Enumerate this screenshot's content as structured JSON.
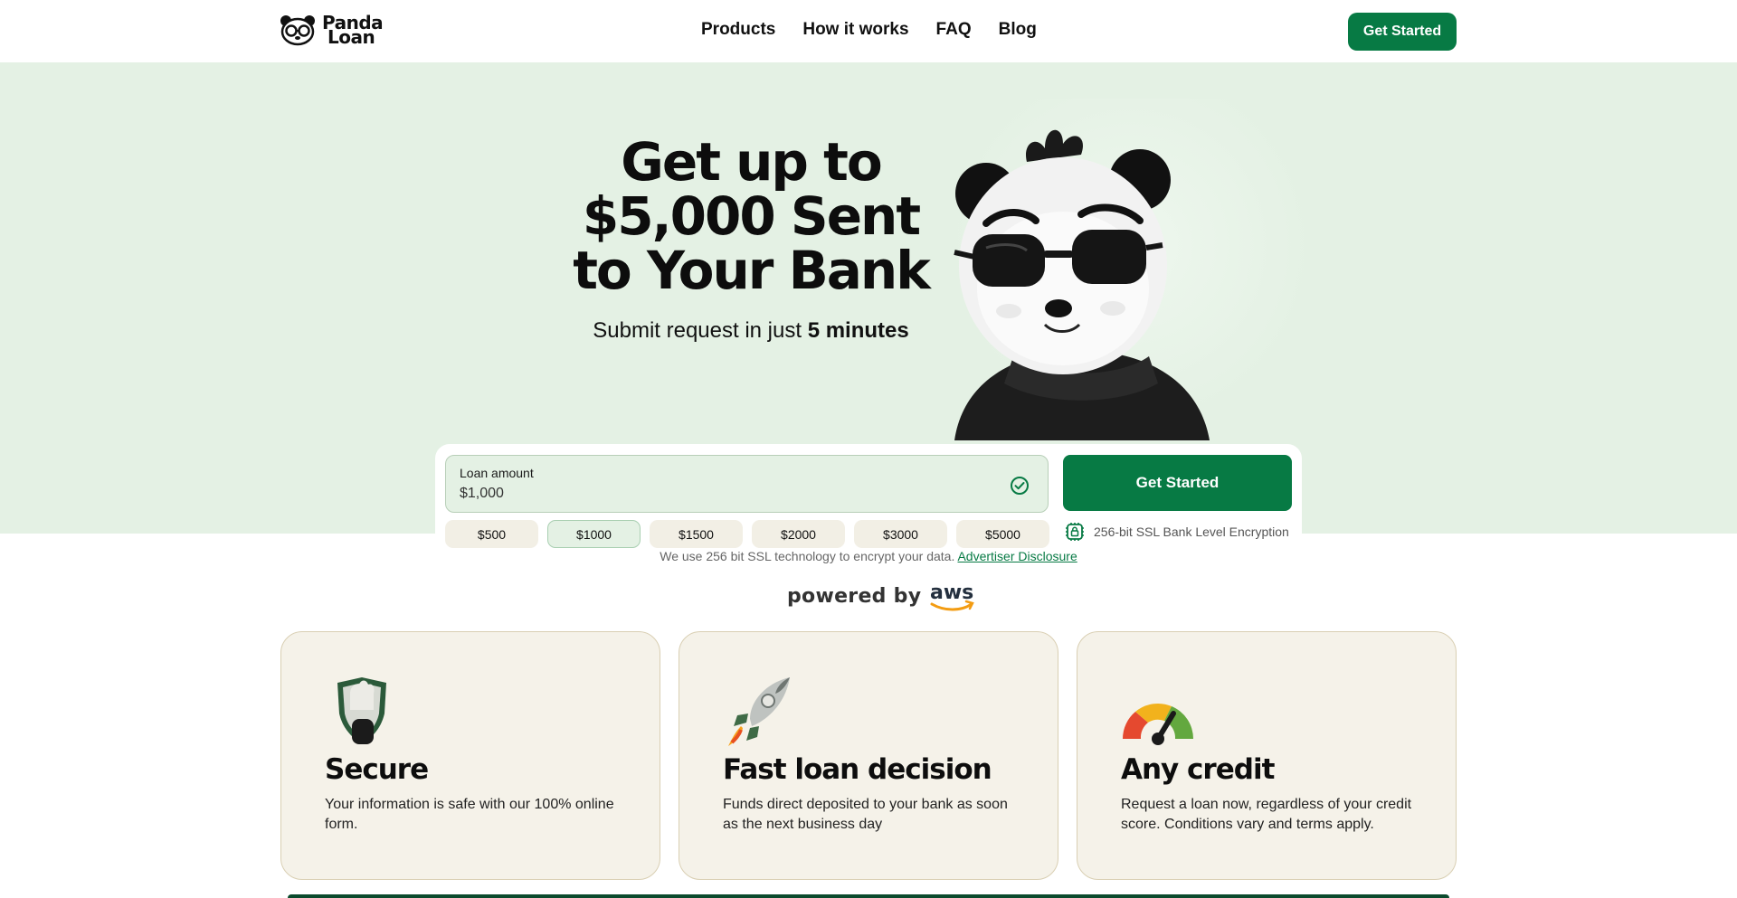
{
  "header": {
    "brand": {
      "line1": "Panda",
      "line2": "Loan",
      "icon": "panda-icon"
    },
    "nav": [
      "Products",
      "How it works",
      "FAQ",
      "Blog"
    ],
    "cta_label": "Get Started"
  },
  "hero": {
    "headline": [
      "Get up to",
      "$5,000 Sent",
      "to Your Bank"
    ],
    "sub_prefix": "Submit request in just ",
    "sub_bold": "5 minutes",
    "mascot": "panda-sunglasses-illustration"
  },
  "loan_form": {
    "label": "Loan amount",
    "value": "$1,000",
    "cta_label": "Get Started",
    "chips": [
      "$500",
      "$1000",
      "$1500",
      "$2000",
      "$3000",
      "$5000"
    ],
    "selected_chip": "$1000",
    "ssl_text": "256-bit SSL Bank Level Encryption"
  },
  "disclaimer": {
    "text": "We use 256 bit SSL technology to encrypt your data.",
    "link": "Advertiser Disclosure"
  },
  "powered": {
    "text": "powered by",
    "logo": "aws"
  },
  "features": [
    {
      "title": "Secure",
      "desc": "Your information is safe with our 100% online form.",
      "icon": "shield-icon"
    },
    {
      "title": "Fast loan decision",
      "desc": "Funds direct deposited to your bank as soon as the next business day",
      "icon": "rocket-icon"
    },
    {
      "title": "Any credit",
      "desc": "Request a loan now, regardless of your credit score. Conditions vary and terms apply.",
      "icon": "gauge-icon"
    }
  ],
  "colors": {
    "brand_green": "#077a44",
    "hero_bg": "#e4f1e4",
    "card_bg": "#f5f2e9"
  }
}
